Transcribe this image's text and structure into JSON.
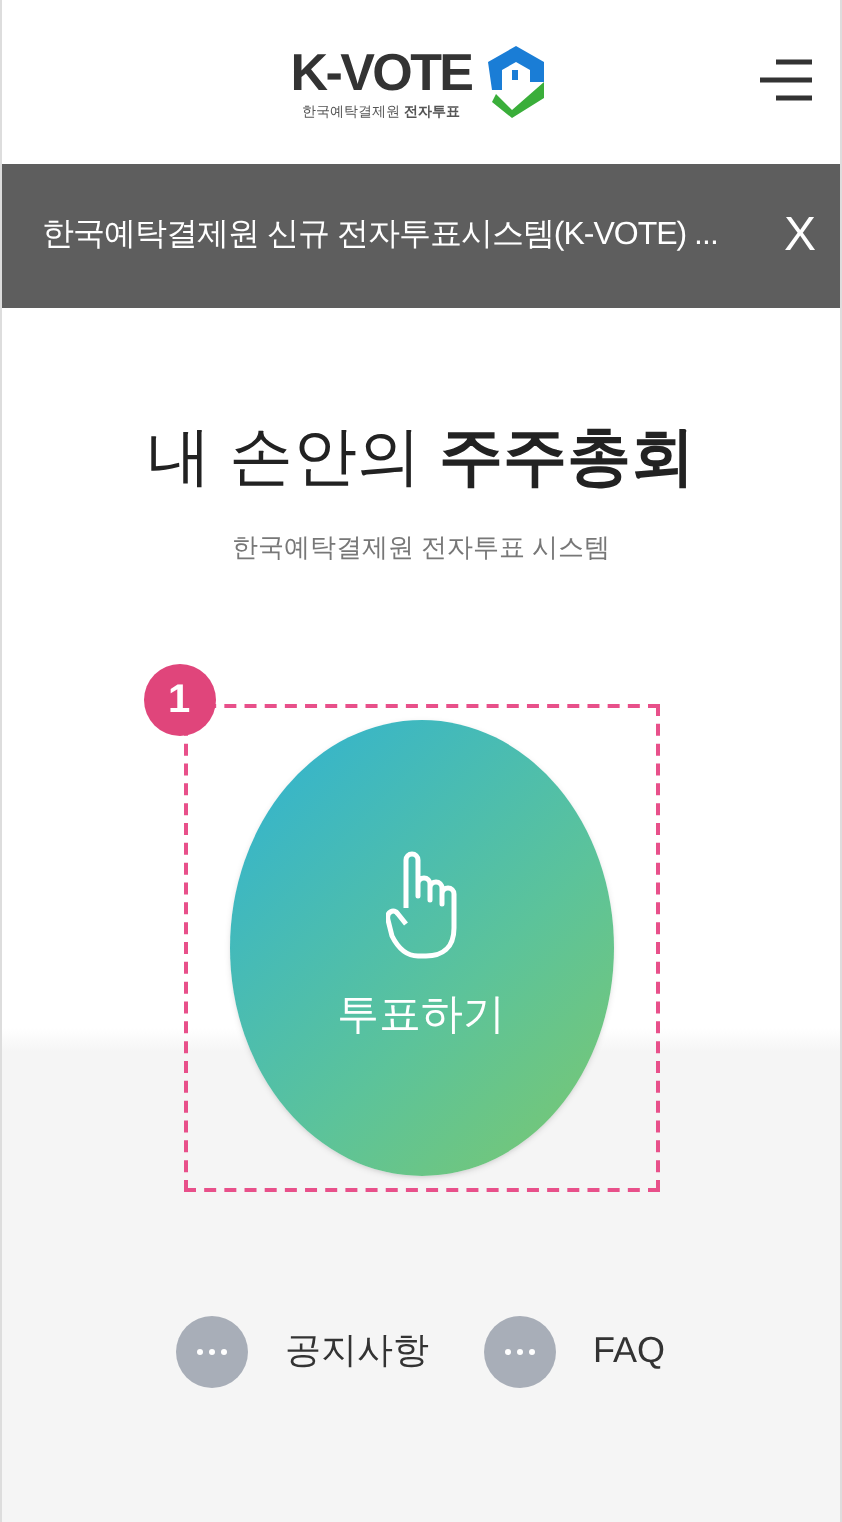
{
  "header": {
    "logo_text": "K-VOTE",
    "logo_subtitle": "한국예탁결제원 **전자투표**"
  },
  "notice_banner": {
    "text": "한국예탁결제원 신규 전자투표시스템(K-VOTE) ...",
    "close": "X"
  },
  "hero": {
    "title": "내 손안의 **주주총회**",
    "subtitle": "한국예탁결제원 전자투표 시스템"
  },
  "vote_button": {
    "step": "1",
    "label": "투표하기"
  },
  "links": [
    {
      "label": "공지사항"
    },
    {
      "label": "FAQ"
    }
  ]
}
